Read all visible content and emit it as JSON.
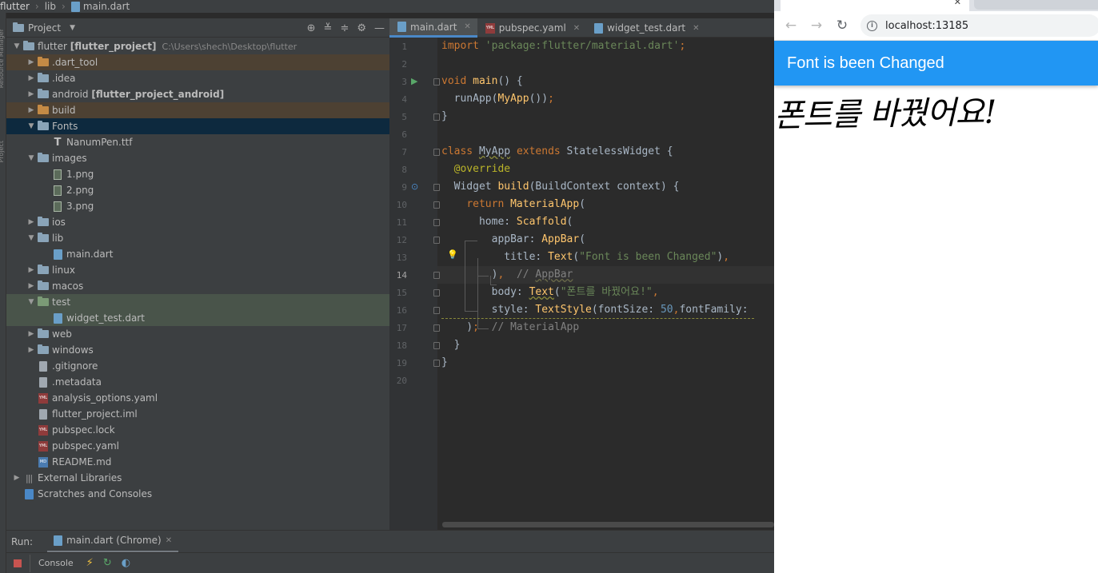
{
  "breadcrumb": [
    "flutter",
    "lib",
    "main.dart"
  ],
  "left_strip": [
    "Resource Manager",
    "Project"
  ],
  "project_panel": {
    "title": "Project",
    "tree": [
      {
        "label": "flutter",
        "bold": "[flutter_project]",
        "path": "C:\\Users\\shech\\Desktop\\flutter",
        "icon": "folder-icon",
        "expanded": true,
        "depth": 0
      },
      {
        "label": ".dart_tool",
        "icon": "folder-orange-icon",
        "expanded": false,
        "depth": 1,
        "state": "excluded"
      },
      {
        "label": ".idea",
        "icon": "folder-icon",
        "expanded": false,
        "depth": 1
      },
      {
        "label": "android",
        "bold": "[flutter_project_android]",
        "icon": "folder-icon",
        "expanded": false,
        "depth": 1
      },
      {
        "label": "build",
        "icon": "folder-orange-icon",
        "expanded": false,
        "depth": 1,
        "state": "excluded"
      },
      {
        "label": "Fonts",
        "icon": "folder-icon",
        "expanded": true,
        "depth": 1,
        "state": "selected"
      },
      {
        "label": "NanumPen.ttf",
        "icon": "font-file-icon",
        "depth": 2
      },
      {
        "label": "images",
        "icon": "folder-icon",
        "expanded": true,
        "depth": 1
      },
      {
        "label": "1.png",
        "icon": "image-file-icon",
        "depth": 2
      },
      {
        "label": "2.png",
        "icon": "image-file-icon",
        "depth": 2
      },
      {
        "label": "3.png",
        "icon": "image-file-icon",
        "depth": 2
      },
      {
        "label": "ios",
        "icon": "folder-icon",
        "expanded": false,
        "depth": 1
      },
      {
        "label": "lib",
        "icon": "folder-icon",
        "expanded": true,
        "depth": 1
      },
      {
        "label": "main.dart",
        "icon": "dart-file-icon",
        "depth": 2
      },
      {
        "label": "linux",
        "icon": "folder-icon",
        "expanded": false,
        "depth": 1
      },
      {
        "label": "macos",
        "icon": "folder-icon",
        "expanded": false,
        "depth": 1
      },
      {
        "label": "test",
        "icon": "folder-green-icon",
        "expanded": true,
        "depth": 1,
        "state": "test"
      },
      {
        "label": "widget_test.dart",
        "icon": "dart-file-icon",
        "depth": 2,
        "state": "test"
      },
      {
        "label": "web",
        "icon": "folder-icon",
        "expanded": false,
        "depth": 1
      },
      {
        "label": "windows",
        "icon": "folder-icon",
        "expanded": false,
        "depth": 1
      },
      {
        "label": ".gitignore",
        "icon": "text-file-icon",
        "depth": 1
      },
      {
        "label": ".metadata",
        "icon": "text-file-icon",
        "depth": 1
      },
      {
        "label": "analysis_options.yaml",
        "icon": "yaml-file-icon",
        "depth": 1
      },
      {
        "label": "flutter_project.iml",
        "icon": "text-file-icon",
        "depth": 1
      },
      {
        "label": "pubspec.lock",
        "icon": "yaml-file-icon",
        "depth": 1
      },
      {
        "label": "pubspec.yaml",
        "icon": "yaml-file-icon",
        "depth": 1
      },
      {
        "label": "README.md",
        "icon": "md-file-icon",
        "depth": 1
      },
      {
        "label": "External Libraries",
        "icon": "library-icon",
        "expanded": false,
        "depth": 0
      },
      {
        "label": "Scratches and Consoles",
        "icon": "scratch-icon",
        "depth": 0
      }
    ]
  },
  "editor": {
    "tabs": [
      {
        "label": "main.dart",
        "icon": "dart-file-icon",
        "active": true
      },
      {
        "label": "pubspec.yaml",
        "icon": "yaml-file-icon",
        "active": false
      },
      {
        "label": "widget_test.dart",
        "icon": "dart-file-icon",
        "active": false
      }
    ],
    "current_line": 14,
    "line_numbers": [
      "1",
      "2",
      "3",
      "4",
      "5",
      "6",
      "7",
      "8",
      "9",
      "10",
      "11",
      "12",
      "13",
      "14",
      "15",
      "16",
      "17",
      "18",
      "19",
      "20"
    ]
  },
  "run_panel": {
    "label": "Run:",
    "tab": "main.dart (Chrome)",
    "console": "Console"
  },
  "browser": {
    "url": "localhost:13185",
    "appbar_title": "Font is been Changed",
    "body_text": "폰트를 바꿨어요!",
    "accent": "#2196f3"
  }
}
